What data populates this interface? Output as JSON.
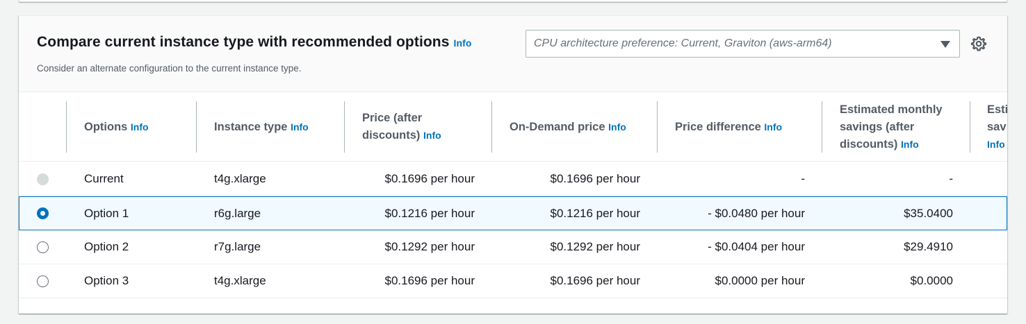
{
  "panel": {
    "title": "Compare current instance type with recommended options",
    "title_info": "Info",
    "description": "Consider an alternate configuration to the current instance type.",
    "cpu_select": {
      "placeholder": "CPU architecture preference: Current, Graviton (aws-arm64)"
    },
    "settings_icon": "gear-icon"
  },
  "table": {
    "columns": [
      {
        "label": "Options",
        "info": "Info"
      },
      {
        "label": "Instance type",
        "info": "Info"
      },
      {
        "label_line1": "Price (after",
        "label_line2": "discounts)",
        "info": "Info"
      },
      {
        "label": "On-Demand price",
        "info": "Info"
      },
      {
        "label": "Price difference",
        "info": "Info"
      },
      {
        "label_line1": "Estimated monthly",
        "label_line2": "savings (after",
        "label_line3": "discounts)",
        "info": "Info"
      },
      {
        "label_line1": "Esti",
        "label_line2": "sav",
        "info": "Info"
      }
    ],
    "rows": [
      {
        "option": "Current",
        "instance_type": "t4g.xlarge",
        "price": "$0.1696 per hour",
        "on_demand": "$0.1696 per hour",
        "price_diff": "-",
        "monthly_savings": "-",
        "radio": "disabled"
      },
      {
        "option": "Option 1",
        "instance_type": "r6g.large",
        "price": "$0.1216 per hour",
        "on_demand": "$0.1216 per hour",
        "price_diff": "- $0.0480 per hour",
        "monthly_savings": "$35.0400",
        "radio": "checked"
      },
      {
        "option": "Option 2",
        "instance_type": "r7g.large",
        "price": "$0.1292 per hour",
        "on_demand": "$0.1292 per hour",
        "price_diff": "- $0.0404 per hour",
        "monthly_savings": "$29.4910",
        "radio": "unchecked"
      },
      {
        "option": "Option 3",
        "instance_type": "t4g.xlarge",
        "price": "$0.1696 per hour",
        "on_demand": "$0.1696 per hour",
        "price_diff": "$0.0000 per hour",
        "monthly_savings": "$0.0000",
        "radio": "unchecked"
      }
    ]
  },
  "colors": {
    "link": "#0073bb",
    "selected_row_bg": "#f1faff",
    "selected_border": "#0073bb"
  }
}
